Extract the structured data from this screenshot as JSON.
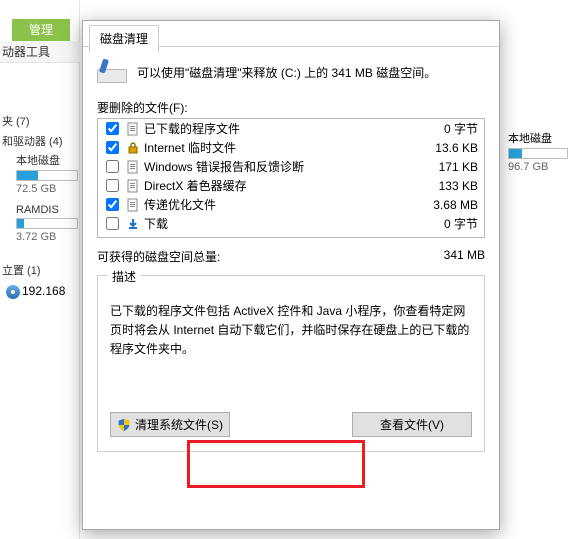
{
  "background": {
    "ribbon_tab": "管理",
    "ribbon_sub": "动器工具",
    "groups": {
      "folders_label": "夹 (7)",
      "drives_label": "和驱动器 (4)",
      "location_label": "立置 (1)"
    },
    "drives": {
      "local": {
        "name": "本地磁盘",
        "capacity": "72.5 GB",
        "fill_pct": 35
      },
      "ram": {
        "name": "RAMDIS",
        "capacity": "3.72 GB",
        "fill_pct": 12
      }
    },
    "network_ip": "192.168",
    "right_drive": {
      "name": "本地磁盘",
      "capacity": "96.7 GB",
      "fill_pct": 22
    }
  },
  "dialog": {
    "tab_label": "磁盘清理",
    "intro_text": "可以使用\"磁盘清理\"来释放  (C:) 上的 341 MB 磁盘空间。",
    "files_label": "要删除的文件(F):",
    "rows": [
      {
        "checked": true,
        "icon": "file-icon",
        "name": "已下载的程序文件",
        "size": "0 字节"
      },
      {
        "checked": true,
        "icon": "lock-icon",
        "name": "Internet 临时文件",
        "size": "13.6 KB"
      },
      {
        "checked": false,
        "icon": "file-icon",
        "name": "Windows 错误报告和反馈诊断",
        "size": "171 KB"
      },
      {
        "checked": false,
        "icon": "file-icon",
        "name": "DirectX 着色器缓存",
        "size": "133 KB"
      },
      {
        "checked": true,
        "icon": "file-icon",
        "name": "传递优化文件",
        "size": "3.68 MB"
      },
      {
        "checked": false,
        "icon": "download-icon",
        "name": "下载",
        "size": "0 字节"
      }
    ],
    "totals_label": "可获得的磁盘空间总量:",
    "totals_value": "341 MB",
    "desc_legend": "描述",
    "desc_text": "已下载的程序文件包括 ActiveX 控件和 Java 小程序，你查看特定网页时将会从 Internet 自动下载它们，并临时保存在硬盘上的已下载的程序文件夹中。",
    "clean_sys_label": "清理系统文件(S)",
    "view_files_label": "查看文件(V)"
  }
}
